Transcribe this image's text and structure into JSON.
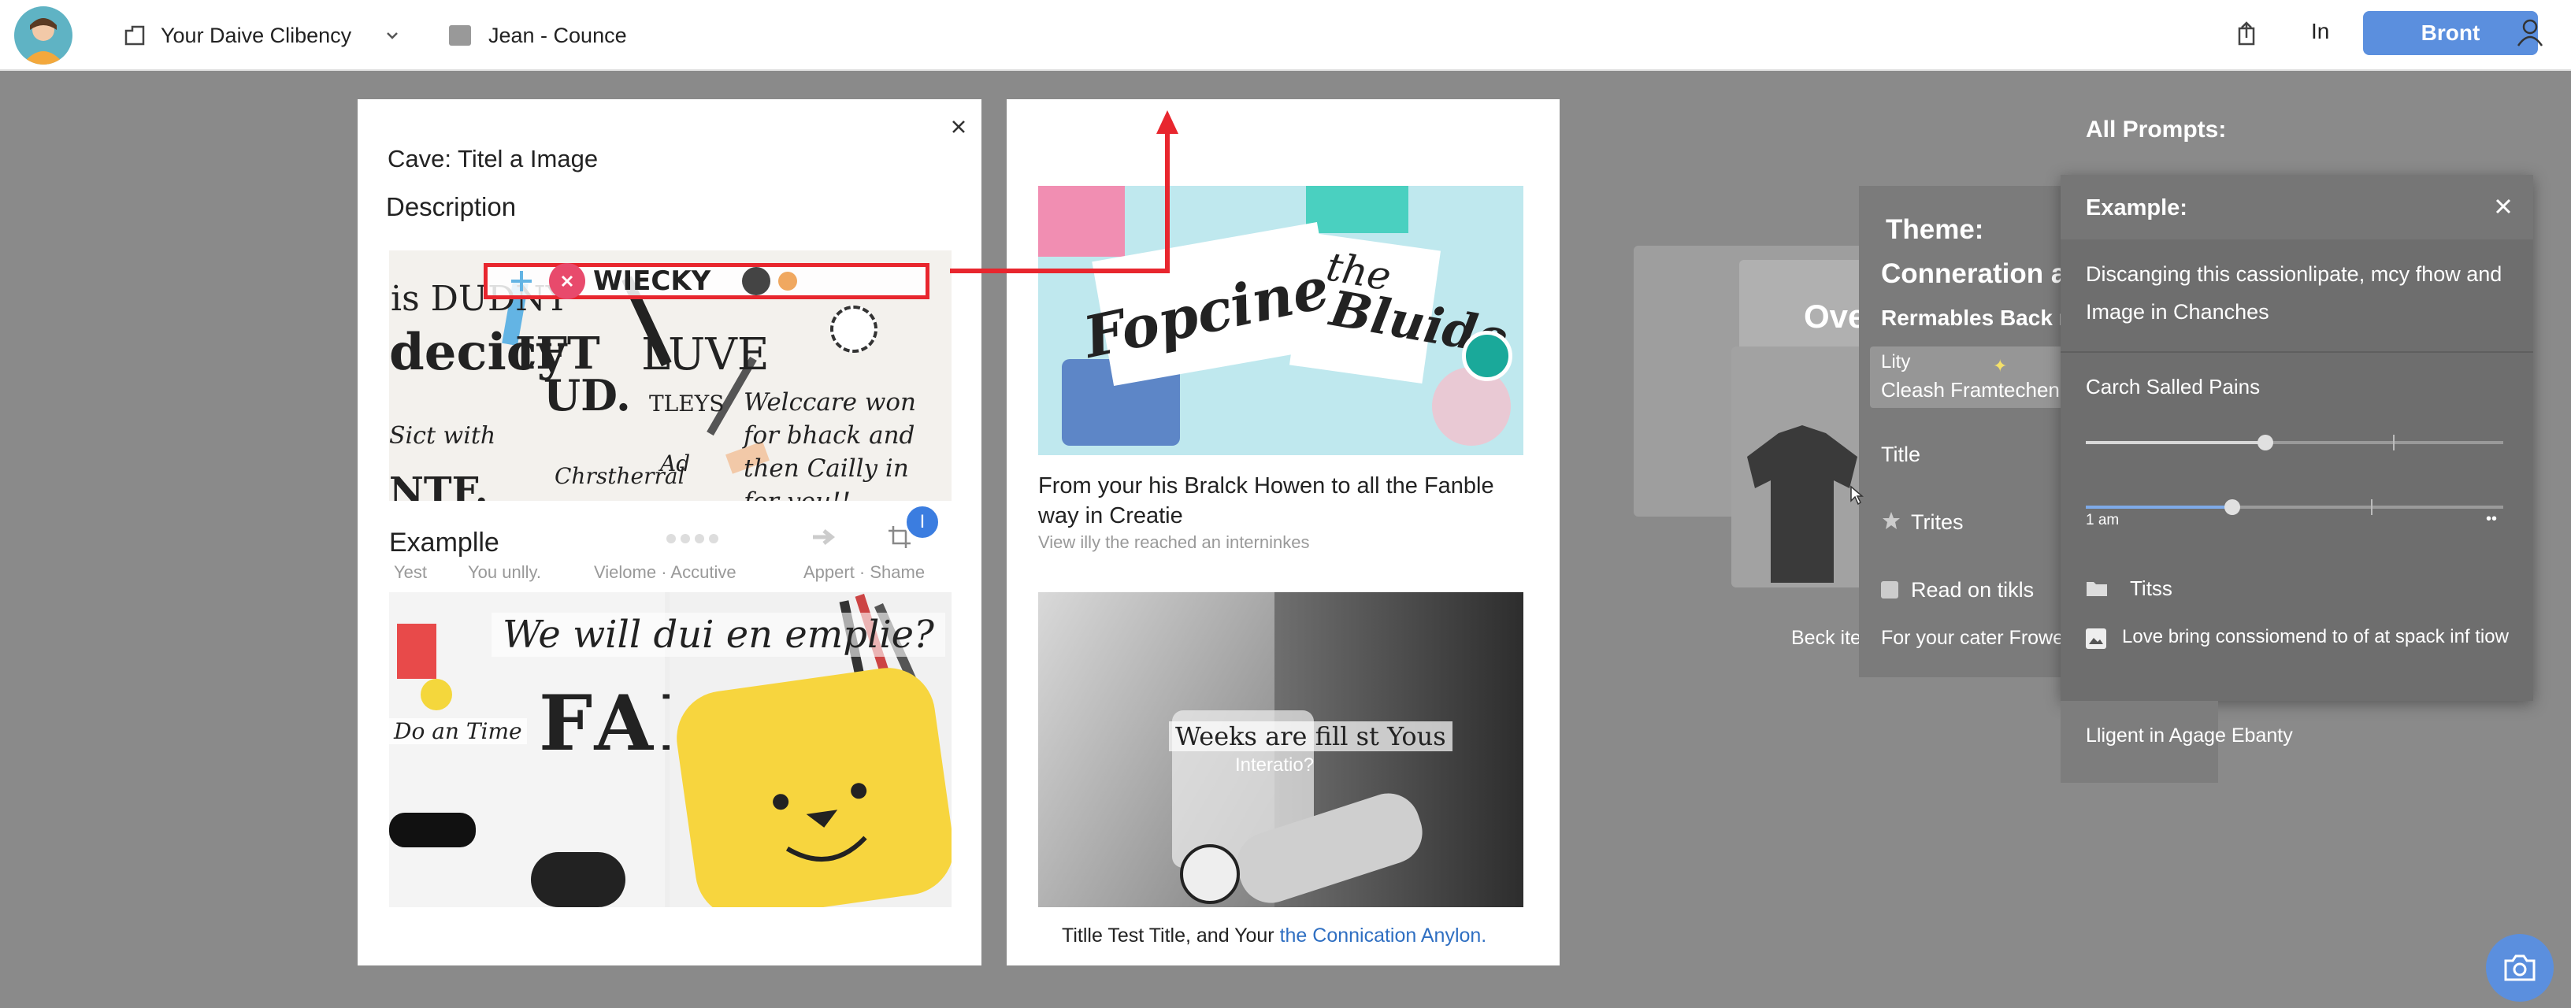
{
  "topbar": {
    "workspace_label": "Your Daive Clibency",
    "doc_label": "Jean - Counce",
    "in_label": "In",
    "primary_button": "Bront"
  },
  "left_card": {
    "title": "Cave: Titel a Image",
    "description": "Description",
    "toolbar_text": "WIECKY",
    "collage_words": [
      "is DUDNY",
      "decicy",
      "IFT",
      "UD.",
      "LUVE",
      "TLEYS",
      "Sict with",
      "NTF.",
      "Chrstherral",
      "Ad"
    ],
    "collage_note": "Welccare won for bhack and then Cailly in for you!!",
    "example_heading": "Examplle",
    "badge": "I",
    "tabs": [
      "Yest",
      "You unlly.",
      "Vielome · Accutive",
      "Appert · Shame"
    ],
    "bottom_collage_caption": "We will dui en emplie?",
    "bottom_collage_note": "Do an Time"
  },
  "right_card": {
    "image_words": [
      "Fopcine",
      "the",
      "Bluide"
    ],
    "caption": "From your his Bralck Howen to all the Fanble way in Creatie",
    "subcaption": "View illy the reached an interninkes",
    "photo_caption_line1": "Weeks are fill st Yous",
    "photo_caption_line2": "Interatio?",
    "footer_text": "Titlle Test Title, and Your",
    "footer_link": "the Connication Anylon."
  },
  "background_panel": {
    "ghost_text": "Ove",
    "beck_label": "Beck ite"
  },
  "theme_panel": {
    "heading": "Theme:",
    "subheading": "Conneration an",
    "line3": "Rermables Back m",
    "selected_line1": "Lity",
    "selected_line2": "Cleash Framtechen",
    "items": [
      "Title",
      "Trites",
      "Read on tikls"
    ],
    "footer": "For your cater Frowe"
  },
  "prompt_panel": {
    "all_prompts_label": "All Prompts:",
    "header": "Example:",
    "description": "Discanging this cassionlipate, mcy fhow and Image in Chanches",
    "slider_label": "Carch Salled Pains",
    "slider1_value": 0.43,
    "slider2_value": 0.35,
    "slider2_label": "1 am",
    "items": [
      "Titss",
      "Love bring conssiomend to of at spack inf tiow"
    ],
    "footer": "Lligent in Agage Ebanty"
  },
  "colors": {
    "accent": "#5b8fde",
    "highlight": "#e8262e",
    "overlay": "#8a8a8a"
  }
}
